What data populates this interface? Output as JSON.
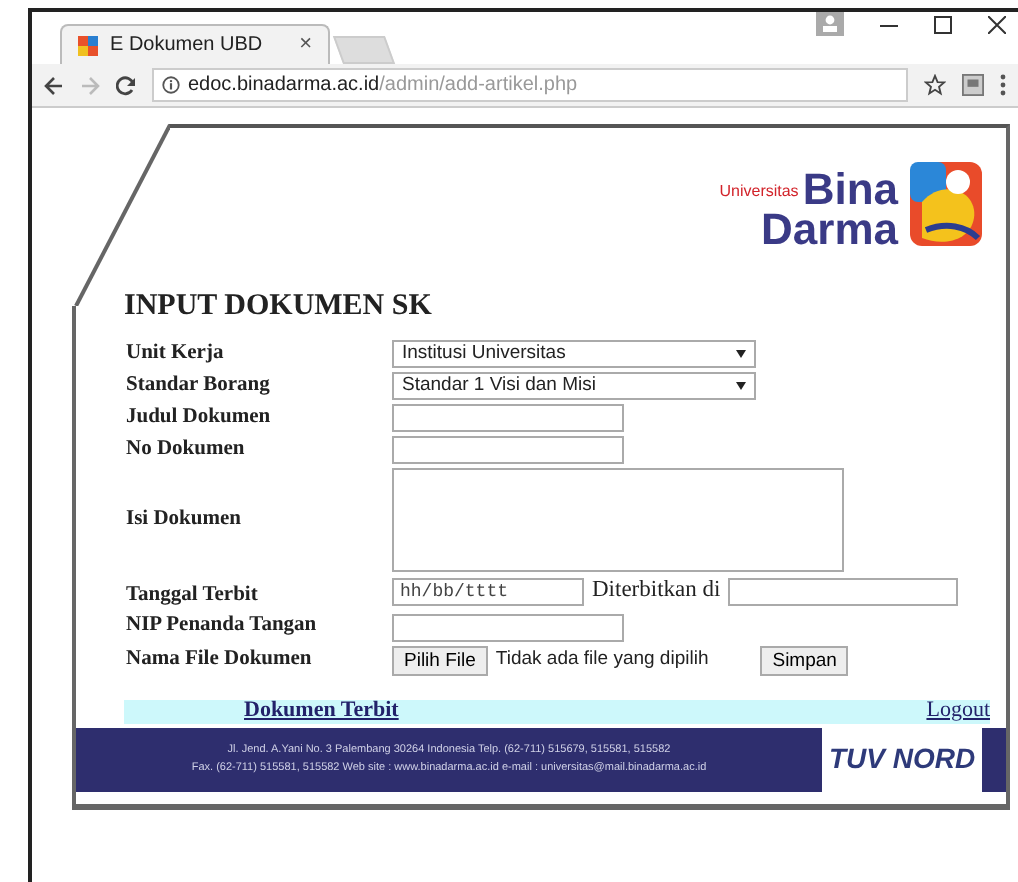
{
  "browser": {
    "tab": {
      "title": "E Dokumen UBD",
      "close": "×"
    },
    "url": {
      "host": "edoc.binadarma.ac.id",
      "path": "/admin/add-artikel.php"
    }
  },
  "header": {
    "logo": {
      "small": "Universitas",
      "line_1": "Bina",
      "line_2": "Darma"
    }
  },
  "title": "INPUT DOKUMEN SK",
  "form": {
    "rows": [
      {
        "kind": "select",
        "label": "Unit Kerja",
        "value": "Institusi Universitas"
      },
      {
        "kind": "select",
        "label": "Standar Borang",
        "value": "Standar 1 Visi dan Misi"
      },
      {
        "kind": "text",
        "label": "Judul Dokumen"
      },
      {
        "kind": "text",
        "label": "No Dokumen"
      },
      {
        "kind": "textarea",
        "label": "Isi Dokumen"
      },
      {
        "kind": "date",
        "label": "Tanggal Terbit",
        "placeholder": "hh/bb/tttt",
        "extra_label": "Diterbitkan di"
      },
      {
        "kind": "text",
        "label": "NIP Penanda Tangan"
      },
      {
        "kind": "file",
        "label": "Nama File Dokumen",
        "button": "Pilih File",
        "status": "Tidak ada file yang dipilih",
        "submit": "Simpan"
      }
    ]
  },
  "nav": {
    "links": [
      "Dokumen Terbit",
      "Logout"
    ]
  },
  "footer": {
    "lines": [
      "Jl. Jend. A.Yani No. 3 Palembang 30264 Indonesia Telp. (62-711) 515679, 515581, 515582",
      "Fax. (62-711) 515581, 515582  Web site : www.binadarma.ac.id e-mail : universitas@mail.binadarma.ac.id"
    ],
    "logo": "TUV NORD"
  }
}
